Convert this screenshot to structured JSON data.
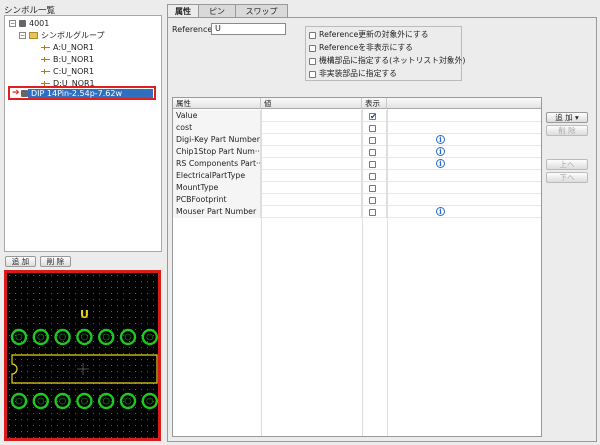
{
  "left_panel": {
    "title": "シンボル一覧",
    "tree": {
      "root": "4001",
      "group": "シンボルグループ",
      "symbols": [
        "A:U_NOR1",
        "B:U_NOR1",
        "C:U_NOR1",
        "D:U_NOR1"
      ],
      "footprint": "DIP 14Pin-2.54p-7.62w"
    },
    "add_label": "追 加",
    "delete_label": "削 除"
  },
  "preview": {
    "ref_text": "U",
    "colors": {
      "background": "#000000",
      "pad": "#1ec81e",
      "silk": "#e6d21e",
      "border": "#d81c1c"
    }
  },
  "tabs": [
    "属性",
    "ピン",
    "スワップ"
  ],
  "attributes": {
    "reference_label": "Reference",
    "reference_value": "U",
    "options": [
      {
        "label": "Reference更新の対象外にする",
        "checked": false
      },
      {
        "label": "Referenceを非表示にする",
        "checked": false
      },
      {
        "label": "機構部品に指定する(ネットリスト対象外)",
        "checked": false
      },
      {
        "label": "非実装部品に指定する",
        "checked": false
      }
    ],
    "grid_headers": [
      "属性",
      "値",
      "表示"
    ],
    "rows": [
      {
        "name": "Value",
        "info": false,
        "show": true
      },
      {
        "name": "cost",
        "info": false,
        "show": false
      },
      {
        "name": "Digi-Key Part Number",
        "info": true,
        "show": false
      },
      {
        "name": "Chip1Stop Part Num···",
        "info": true,
        "show": false
      },
      {
        "name": "RS Components Part···",
        "info": true,
        "show": false
      },
      {
        "name": "ElectricalPartType",
        "info": false,
        "show": false
      },
      {
        "name": "MountType",
        "info": false,
        "show": false
      },
      {
        "name": "PCBFootprint",
        "info": false,
        "show": false
      },
      {
        "name": "Mouser Part Number",
        "info": true,
        "show": false
      }
    ],
    "info_glyph": "i",
    "buttons": {
      "add": "追 加 ▾",
      "delete": "削 除",
      "up": "上へ",
      "down": "下へ"
    }
  }
}
